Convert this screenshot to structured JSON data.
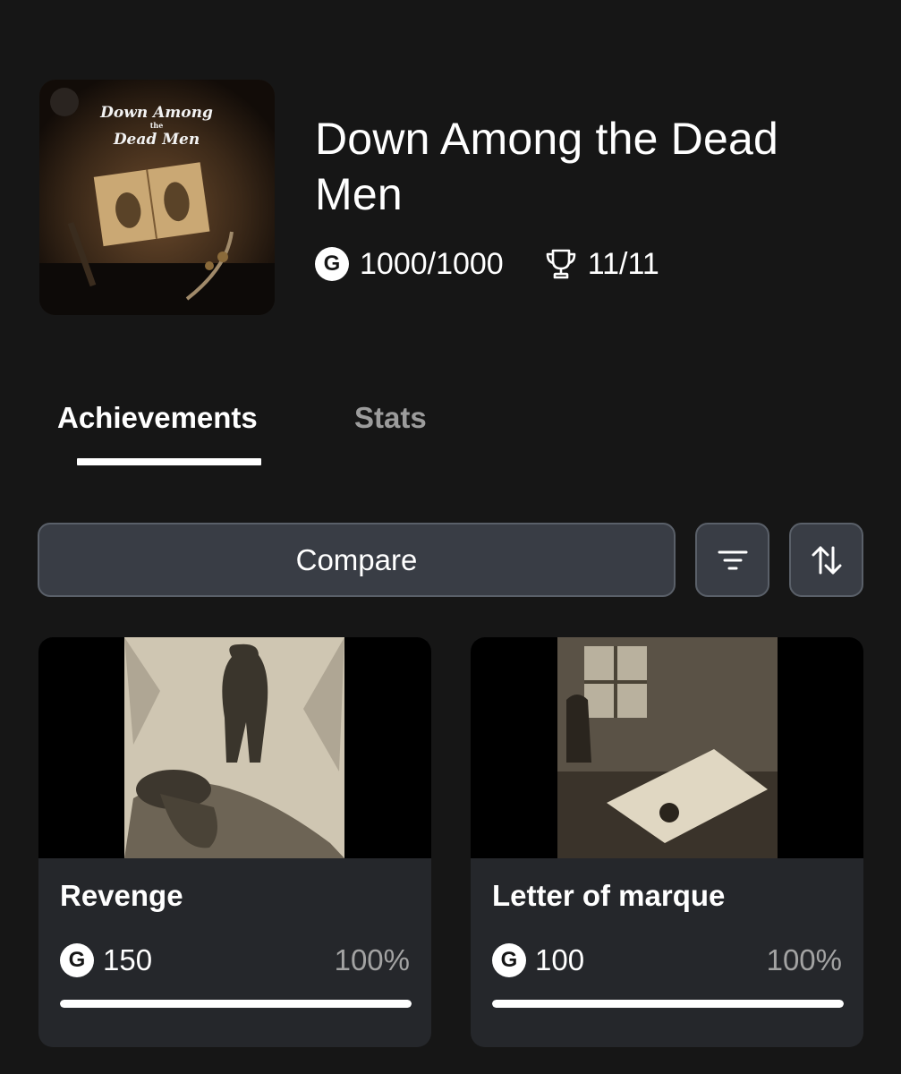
{
  "game": {
    "title": "Down Among the Dead Men",
    "cover_text_line1": "Down Among",
    "cover_text_line2": "the",
    "cover_text_line3": "Dead Men",
    "gamerscore": "1000/1000",
    "achievements_count": "11/11",
    "gamerscore_icon_letter": "G"
  },
  "tabs": [
    {
      "label": "Achievements",
      "active": true
    },
    {
      "label": "Stats",
      "active": false
    }
  ],
  "toolbar": {
    "compare_label": "Compare",
    "filter_icon": "filter-icon",
    "sort_icon": "sort-icon"
  },
  "achievements": [
    {
      "name": "Revenge",
      "gamerscore": "150",
      "percent": "100%",
      "progress": 1.0
    },
    {
      "name": "Letter of marque",
      "gamerscore": "100",
      "percent": "100%",
      "progress": 1.0
    }
  ],
  "colors": {
    "background": "#161616",
    "card": "#25272b",
    "button": "#393d45",
    "inactive_tab": "#9c9c9c",
    "progress_fill": "#ffffff"
  }
}
